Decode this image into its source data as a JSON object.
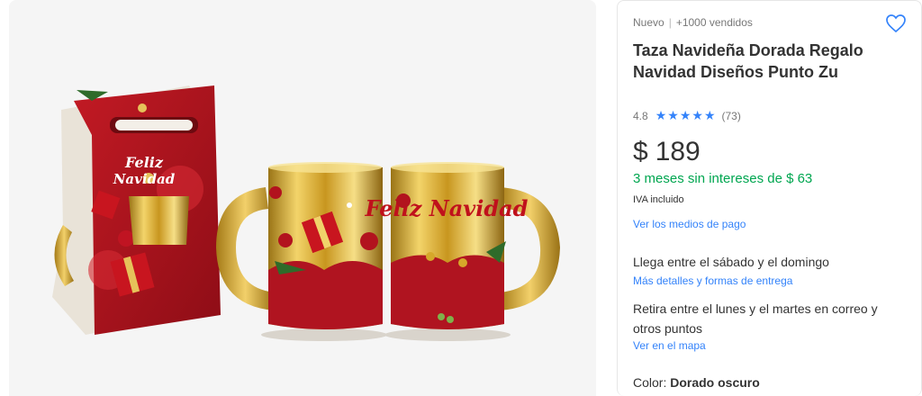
{
  "product": {
    "condition": "Nuevo",
    "separator": "|",
    "sold": "+1000 vendidos",
    "title": "Taza Navideña Dorada Regalo Navidad Diseños Punto Zu",
    "rating_value": "4.8",
    "rating_stars": 5,
    "rating_count": "(73)",
    "price_currency": "$",
    "price_amount": "189",
    "installments": "3 meses sin intereses de $ 63",
    "iva": "IVA incluido",
    "payment_link": "Ver los medios de pago"
  },
  "shipping": {
    "arrival": "Llega entre el sábado y el domingo",
    "details_link": "Más detalles y formas de entrega",
    "pickup": "Retira entre el lunes y el martes en correo y otros puntos",
    "map_link": "Ver en el mapa"
  },
  "variant": {
    "color_label": "Color: ",
    "color_value": "Dorado oscuro"
  },
  "image": {
    "caption_text": "Feliz Navidad"
  },
  "colors": {
    "accent": "#3483fa",
    "green": "#00a650",
    "gold": "#c9a227",
    "red": "#b2131e"
  },
  "icons": {
    "favorite": "heart-icon",
    "star": "star-icon"
  }
}
